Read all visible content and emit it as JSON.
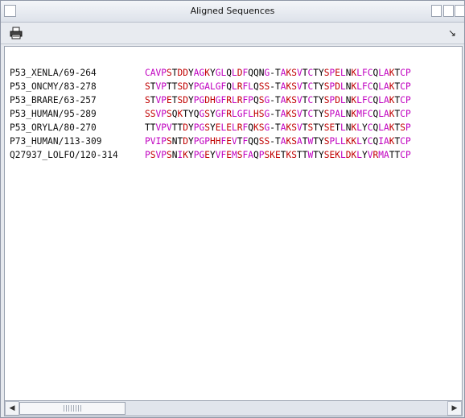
{
  "window": {
    "title": "Aligned Sequences"
  },
  "toolbar": {
    "print_icon": "printer-icon",
    "collapse_icon": "arrow-icon",
    "collapse_symbol": "↘"
  },
  "colors": {
    "magenta": "#c000c0",
    "red": "#c00000",
    "black": "#000000",
    "bg": "#ffffff"
  },
  "alignment": [
    {
      "name": "P53_XENLA/69-264",
      "sequence": "CAVPSTDDYAGKYGLQLDFQQNG-TAKSVTCTYSPELNKLFCQLAKTCP"
    },
    {
      "name": "P53_ONCMY/83-278",
      "sequence": "STVPTTSDYPGALGFQLRFLQSS-TAKSVTCTYSPDLNKLFCQLAKTCP"
    },
    {
      "name": "P53_BRARE/63-257",
      "sequence": "STVPETSDYPGDHGFRLRFPQSG-TAKSVTCTYSPDLNKLFCQLAKTCP"
    },
    {
      "name": "P53_HUMAN/95-289",
      "sequence": "SSVPSQKTYQGSYGFRLGFLHSG-TAKSVTCTYSPALNKMFCQLAKTCP"
    },
    {
      "name": "P53_ORYLA/80-270",
      "sequence": "TTVPVTTDYPGSYELELRFQKSG-TAKSVTSTYSETLNKLYCQLAKTSP"
    },
    {
      "name": "P73_HUMAN/113-309",
      "sequence": "PVIPSNTDYPGPHHFEVTFQQSS-TAKSATWTYSPLLKKLYCQIAKTCP"
    },
    {
      "name": "Q27937_LOLFO/120-314",
      "sequence": "PSVPSNIKYPGEYVFEMSFAQPSKETKSTTWTYSEKLDKLYVRMATTCP"
    }
  ],
  "scroll": {
    "left_label": "◀",
    "right_label": "▶",
    "position_fraction": 0.0
  }
}
